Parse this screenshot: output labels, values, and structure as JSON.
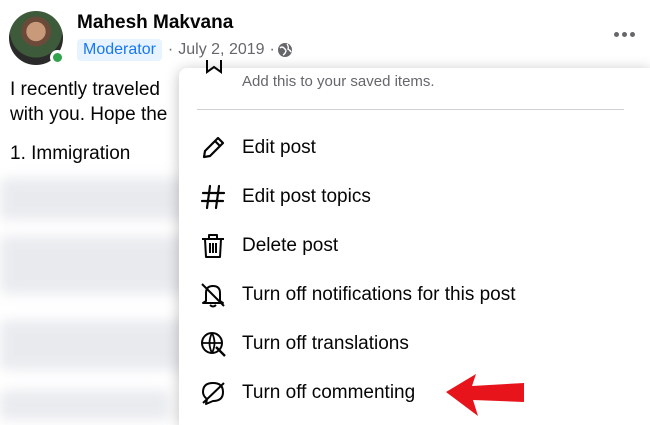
{
  "post": {
    "author": "Mahesh Makvana",
    "badge": "Moderator",
    "date": "July 2, 2019",
    "separator": "·",
    "audience_icon": "globe-icon",
    "more_icon": "more-options-icon",
    "body_line1": "I recently traveled",
    "body_line2": "with you. Hope the",
    "heading": "1. Immigration"
  },
  "menu": {
    "saved_subtitle": "Add this to your saved items.",
    "items": [
      {
        "label": "Edit post",
        "icon": "pencil-icon"
      },
      {
        "label": "Edit post topics",
        "icon": "hashtag-icon"
      },
      {
        "label": "Delete post",
        "icon": "trash-icon"
      },
      {
        "label": "Turn off notifications for this post",
        "icon": "bell-off-icon"
      },
      {
        "label": "Turn off translations",
        "icon": "globe-translate-icon"
      },
      {
        "label": "Turn off commenting",
        "icon": "comment-off-icon"
      }
    ]
  },
  "colors": {
    "accent": "#1877f2",
    "badge_bg": "#e7f3ff",
    "online": "#31a24c",
    "secondary_text": "#65676b",
    "annotation_arrow": "#e8141c"
  }
}
